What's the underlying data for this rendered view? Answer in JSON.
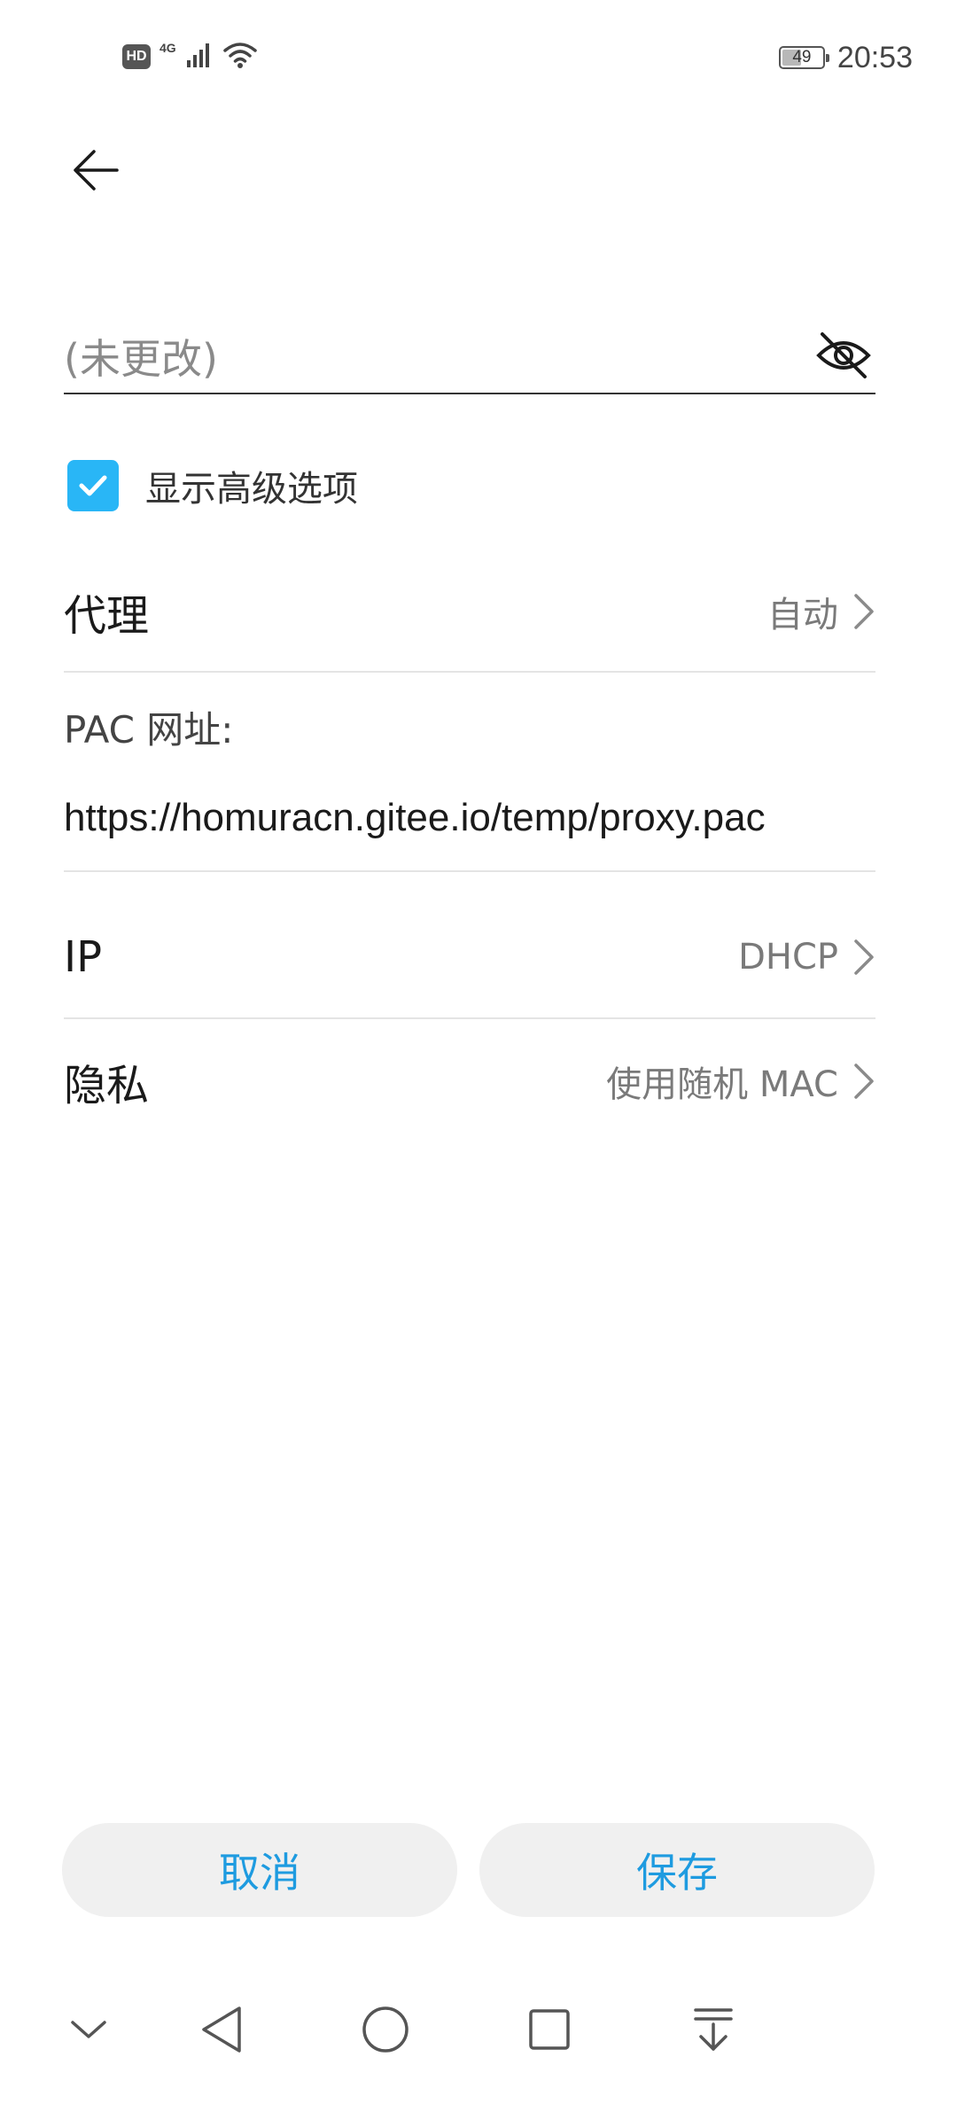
{
  "status_bar": {
    "hd_badge": "HD",
    "network_type": "4G",
    "battery_level": "49",
    "battery_fraction": 0.49,
    "time": "20:53",
    "icons": [
      "hd-icon",
      "signal-icon",
      "wifi-icon",
      "battery-icon"
    ]
  },
  "header": {
    "back_icon": "back-arrow-icon"
  },
  "password": {
    "placeholder": "(未更改)",
    "visibility_icon": "eye-hidden-icon"
  },
  "advanced": {
    "checkbox_label": "显示高级选项",
    "checked": true
  },
  "settings": {
    "proxy": {
      "label": "代理",
      "value": "自动"
    },
    "pac": {
      "label": "PAC 网址:",
      "value": "https://homuracn.gitee.io/temp/proxy.pac"
    },
    "ip": {
      "label": "IP",
      "value": "DHCP"
    },
    "privacy": {
      "label": "隐私",
      "value": "使用随机 MAC"
    }
  },
  "actions": {
    "cancel_label": "取消",
    "save_label": "保存"
  },
  "colors": {
    "accent": "#1e9be0",
    "checkbox": "#29b6f6",
    "button_bg": "#f0f0f0"
  },
  "navigation": {
    "icons": [
      "chevron-down-icon",
      "nav-back-icon",
      "nav-home-icon",
      "nav-recents-icon",
      "notification-pull-icon"
    ]
  }
}
